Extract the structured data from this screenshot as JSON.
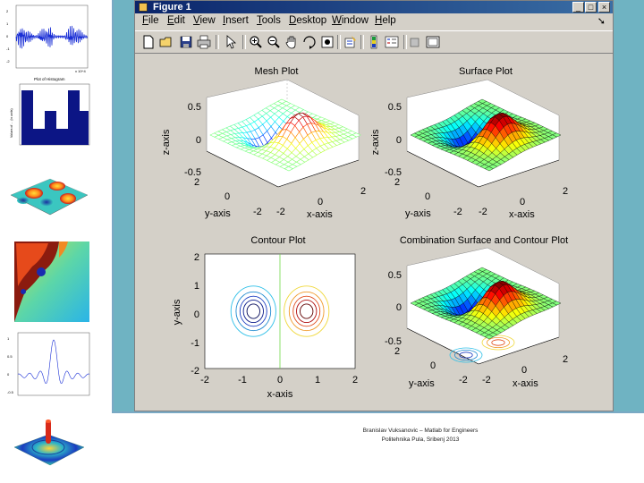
{
  "window": {
    "title": "Figure 1"
  },
  "menu": {
    "items": [
      {
        "label": "File",
        "key": "F"
      },
      {
        "label": "Edit",
        "key": "E"
      },
      {
        "label": "View",
        "key": "V"
      },
      {
        "label": "Insert",
        "key": "I"
      },
      {
        "label": "Tools",
        "key": "T"
      },
      {
        "label": "Desktop",
        "key": "D"
      },
      {
        "label": "Window",
        "key": "W"
      },
      {
        "label": "Help",
        "key": "H"
      }
    ]
  },
  "toolbar": {
    "buttons": [
      "new-figure-icon",
      "open-file-icon",
      "save-icon",
      "print-icon",
      "edit-plot-arrow-icon",
      "zoom-in-icon",
      "zoom-out-icon",
      "pan-hand-icon",
      "rotate-3d-icon",
      "data-cursor-icon",
      "insert-colorbar-icon",
      "insert-legend-icon",
      "hide-plot-tools-icon",
      "show-plot-tools-icon"
    ]
  },
  "plots": {
    "mesh": {
      "title": "Mesh Plot",
      "xlabel": "x-axis",
      "ylabel": "y-axis",
      "zlabel": "z-axis",
      "zticks": [
        "0.5",
        "0",
        "-0.5"
      ],
      "xticks": [
        "2",
        "0",
        "-2"
      ],
      "yticks": [
        "2",
        "0",
        "-2"
      ]
    },
    "surface": {
      "title": "Surface Plot",
      "xlabel": "x-axis",
      "ylabel": "y-axis",
      "zlabel": "z-axis",
      "zticks": [
        "0.5",
        "0",
        "-0.5"
      ],
      "xticks": [
        "2",
        "0",
        "-2"
      ],
      "yticks": [
        "2",
        "0",
        "-2"
      ]
    },
    "contour": {
      "title": "Contour Plot",
      "xlabel": "x-axis",
      "ylabel": "y-axis",
      "xticks": [
        "-2",
        "-1",
        "0",
        "1",
        "2"
      ],
      "yticks": [
        "2",
        "1",
        "0",
        "-1",
        "-2"
      ]
    },
    "combo": {
      "title": "Combination Surface and Contour Plot",
      "xlabel": "x-axis",
      "ylabel": "y-axis",
      "zticks": [
        "0.5",
        "0",
        "-0.5"
      ],
      "xticks": [
        "2",
        "0",
        "-2"
      ],
      "yticks": [
        "2",
        "0",
        "-2"
      ]
    }
  },
  "thumbnails": {
    "signal": {
      "yticks": [
        "2",
        "1",
        "0",
        "-1",
        "-2"
      ],
      "xlabel": "x 10^4"
    },
    "histogram": {
      "title": "Plot of Histogram",
      "ylabel": "Values of ... (in units)"
    },
    "sinc": {
      "yticks": [
        "1",
        "0.5",
        "0",
        "-0.5"
      ]
    }
  },
  "caption": {
    "line1": "Branislav Vuksanovic – Matlab for Engineers",
    "line2": "Politehnika Pula, Sribenj 2013"
  }
}
